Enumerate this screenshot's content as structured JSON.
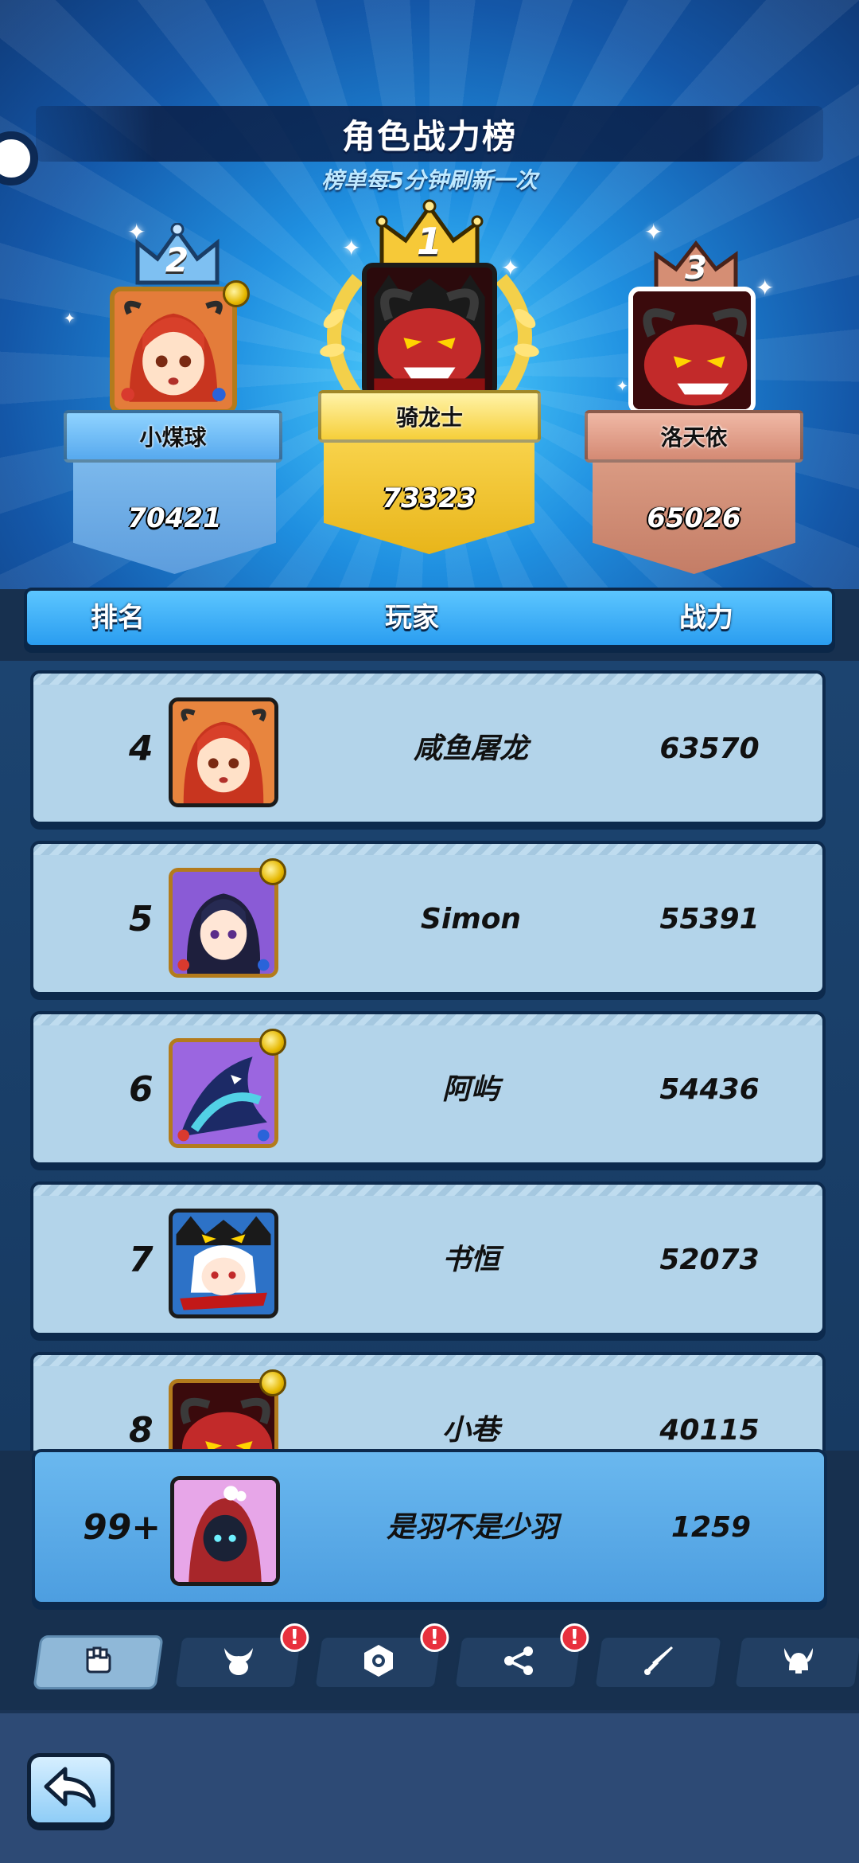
{
  "header": {
    "title": "角色战力榜",
    "subtitle": "榜单每5分钟刷新一次"
  },
  "podium": {
    "first": {
      "rank": "1",
      "name": "骑龙士",
      "power": "73323"
    },
    "second": {
      "rank": "2",
      "name": "小煤球",
      "power": "70421"
    },
    "third": {
      "rank": "3",
      "name": "洛天依",
      "power": "65026"
    }
  },
  "table": {
    "columns": {
      "rank": "排名",
      "player": "玩家",
      "power": "战力"
    },
    "rows": [
      {
        "rank": "4",
        "name": "咸鱼屠龙",
        "power": "63570"
      },
      {
        "rank": "5",
        "name": "Simon",
        "power": "55391"
      },
      {
        "rank": "6",
        "name": "阿屿",
        "power": "54436"
      },
      {
        "rank": "7",
        "name": "书恒",
        "power": "52073"
      },
      {
        "rank": "8",
        "name": "小巷",
        "power": "40115"
      }
    ]
  },
  "my_rank": {
    "rank": "99+",
    "name": "是羽不是少羽",
    "power": "1259"
  },
  "tabs": [
    {
      "icon": "fist-icon",
      "active": true,
      "badge": ""
    },
    {
      "icon": "demon-horns-icon",
      "active": false,
      "badge": "!"
    },
    {
      "icon": "shield-emblem-icon",
      "active": false,
      "badge": "!"
    },
    {
      "icon": "share-nodes-icon",
      "active": false,
      "badge": "!"
    },
    {
      "icon": "sword-icon",
      "active": false,
      "badge": ""
    },
    {
      "icon": "viking-helmet-icon",
      "active": false,
      "badge": ""
    }
  ],
  "bottom": {
    "back_icon": "back-arrow-icon"
  },
  "colors": {
    "gold": "#f6c938",
    "silver_blue": "#6fb6ee",
    "bronze": "#d48a74",
    "row_bg": "#b3d4ea",
    "my_row_bg": "#5aa8e6",
    "badge_red": "#e8303d"
  }
}
